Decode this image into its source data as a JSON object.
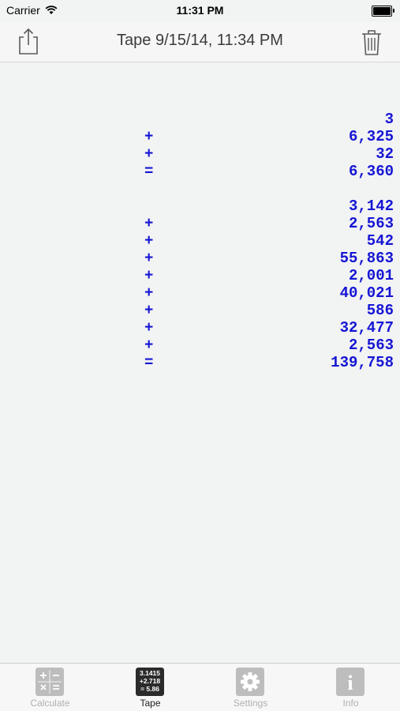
{
  "status": {
    "carrier": "Carrier",
    "time": "11:31 PM"
  },
  "nav": {
    "title": "Tape 9/15/14, 11:34 PM",
    "share_icon": "share-icon",
    "trash_icon": "trash-icon"
  },
  "tape": [
    {
      "op": "",
      "value": "3"
    },
    {
      "op": "+",
      "value": "6,325"
    },
    {
      "op": "+",
      "value": "32"
    },
    {
      "op": "=",
      "value": "6,360"
    },
    {
      "op": "",
      "value": ""
    },
    {
      "op": "",
      "value": "3,142"
    },
    {
      "op": "+",
      "value": "2,563"
    },
    {
      "op": "+",
      "value": "542"
    },
    {
      "op": "+",
      "value": "55,863"
    },
    {
      "op": "+",
      "value": "2,001"
    },
    {
      "op": "+",
      "value": "40,021"
    },
    {
      "op": "+",
      "value": "586"
    },
    {
      "op": "+",
      "value": "32,477"
    },
    {
      "op": "+",
      "value": "2,563"
    },
    {
      "op": "=",
      "value": "139,758"
    }
  ],
  "tabs": [
    {
      "label": "Calculate",
      "icon": "calculator-icon"
    },
    {
      "label": "Tape",
      "icon": "tape-icon",
      "icon_lines": [
        "3.1415",
        "+2.718",
        "= 5.86"
      ]
    },
    {
      "label": "Settings",
      "icon": "gear-icon"
    },
    {
      "label": "Info",
      "icon": "info-icon",
      "icon_text": "i"
    }
  ],
  "colors": {
    "tape_text": "#1515d4",
    "background": "#f2f3f3",
    "inactive_tab": "#b0b0b0"
  }
}
